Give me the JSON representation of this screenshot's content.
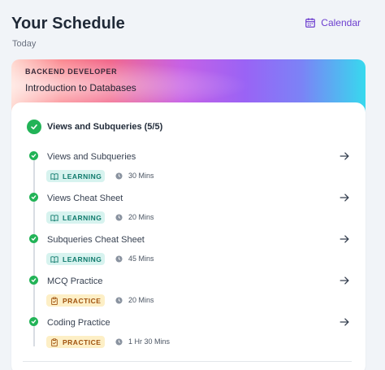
{
  "header": {
    "title": "Your Schedule",
    "calendar_label": "Calendar",
    "subtitle": "Today"
  },
  "course": {
    "tag": "BACKEND DEVELOPER",
    "title": "Introduction to Databases"
  },
  "module": {
    "title": "Views and Subqueries (5/5)"
  },
  "items": [
    {
      "title": "Views and Subqueries",
      "type": "LEARNING",
      "duration": "30 Mins"
    },
    {
      "title": "Views Cheat Sheet",
      "type": "LEARNING",
      "duration": "20 Mins"
    },
    {
      "title": "Subqueries Cheat Sheet",
      "type": "LEARNING",
      "duration": "45 Mins"
    },
    {
      "title": "MCQ Practice",
      "type": "PRACTICE",
      "duration": "20 Mins"
    },
    {
      "title": "Coding Practice",
      "type": "PRACTICE",
      "duration": "1 Hr 30 Mins"
    }
  ],
  "colors": {
    "accent": "#6d3fcf",
    "success": "#22b357",
    "learning_bg": "#d7f3ef",
    "learning_text": "#0f7a6c",
    "practice_bg": "#fdefc6",
    "practice_text": "#a0520e"
  },
  "icons": {
    "calendar": "calendar-icon",
    "check": "check-icon",
    "arrow": "arrow-right-icon",
    "learning": "book-icon",
    "practice": "clipboard-icon",
    "duration": "clock-icon"
  }
}
